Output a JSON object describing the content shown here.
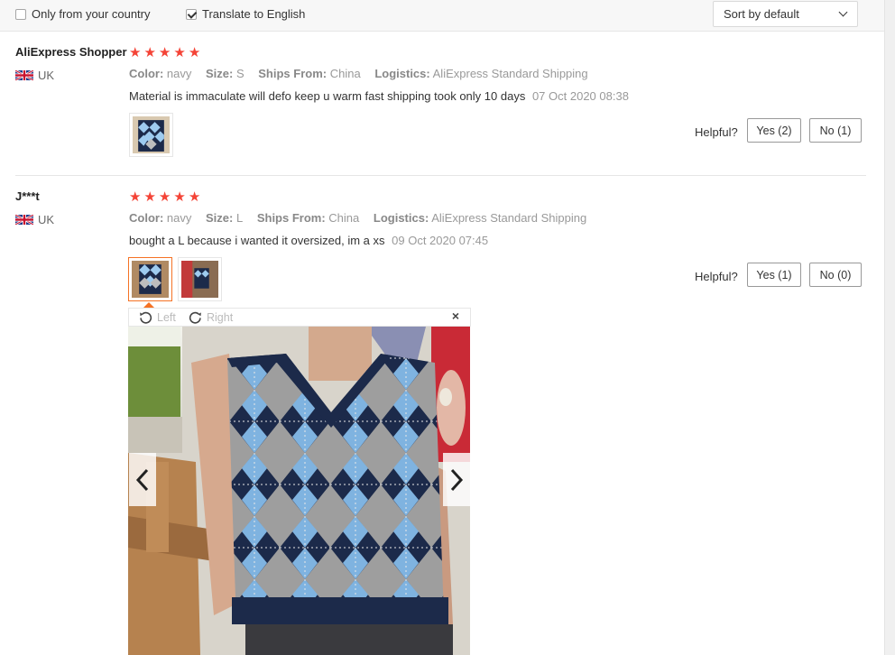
{
  "filters": {
    "only_country_label": "Only from your country",
    "only_country_checked": false,
    "translate_label": "Translate to English",
    "translate_checked": true,
    "sort_label": "Sort by default"
  },
  "reviews": [
    {
      "user": "AliExpress Shopper",
      "country": "UK",
      "stars": 5,
      "color_key": "Color:",
      "color_val": "navy",
      "size_key": "Size:",
      "size_val": "S",
      "ships_key": "Ships From:",
      "ships_val": "China",
      "logistics_key": "Logistics:",
      "logistics_val": "AliExpress Standard Shipping",
      "text": "Material is immaculate will defo keep u warm fast shipping took only 10 days",
      "date": "07 Oct 2020 08:38",
      "helpful_label": "Helpful?",
      "yes_label": "Yes (2)",
      "no_label": "No (1)"
    },
    {
      "user": "J***t",
      "country": "UK",
      "stars": 5,
      "color_key": "Color:",
      "color_val": "navy",
      "size_key": "Size:",
      "size_val": "L",
      "ships_key": "Ships From:",
      "ships_val": "China",
      "logistics_key": "Logistics:",
      "logistics_val": "AliExpress Standard Shipping",
      "text": "bought a L because i wanted it oversized, im a xs",
      "date": "09 Oct 2020 07:45",
      "helpful_label": "Helpful?",
      "yes_label": "Yes (1)",
      "no_label": "No (0)"
    }
  ],
  "viewer": {
    "rotate_left_label": "Left",
    "rotate_right_label": "Right",
    "close_label": "×"
  },
  "colors": {
    "star": "#f44336",
    "accent": "#f57224",
    "sweater_navy": "#1c2a4a",
    "sweater_blue": "#7fb3e0",
    "sweater_grey": "#9e9e9e"
  }
}
